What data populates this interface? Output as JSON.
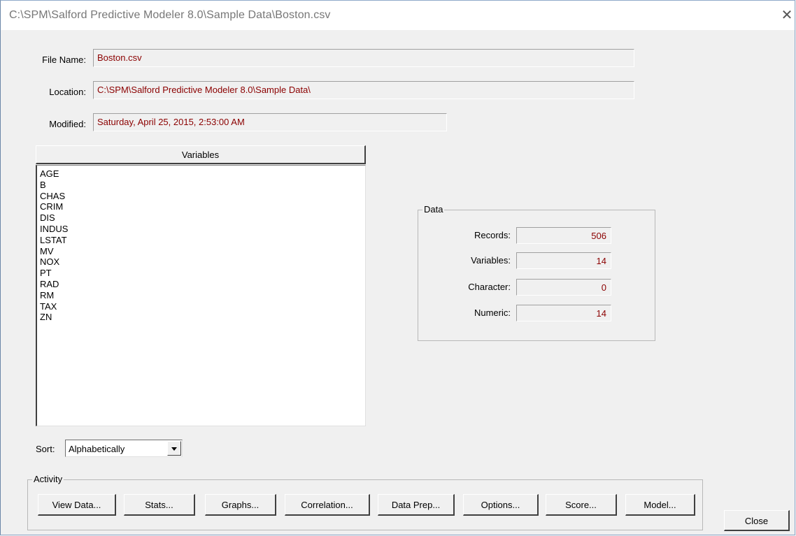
{
  "window": {
    "title": "C:\\SPM\\Salford Predictive Modeler 8.0\\Sample Data\\Boston.csv"
  },
  "file_info": {
    "file_name_label": "File Name:",
    "file_name": "Boston.csv",
    "location_label": "Location:",
    "location": "C:\\SPM\\Salford Predictive Modeler 8.0\\Sample Data\\",
    "modified_label": "Modified:",
    "modified": "Saturday, April 25, 2015, 2:53:00 AM"
  },
  "variables": {
    "header": "Variables",
    "items": [
      "AGE",
      "B",
      "CHAS",
      "CRIM",
      "DIS",
      "INDUS",
      "LSTAT",
      "MV",
      "NOX",
      "PT",
      "RAD",
      "RM",
      "TAX",
      "ZN"
    ]
  },
  "sort": {
    "label": "Sort:",
    "selected": "Alphabetically"
  },
  "data_group": {
    "title": "Data",
    "rows": [
      {
        "label": "Records:",
        "value": "506"
      },
      {
        "label": "Variables:",
        "value": "14"
      },
      {
        "label": "Character:",
        "value": "0"
      },
      {
        "label": "Numeric:",
        "value": "14"
      }
    ]
  },
  "activity": {
    "title": "Activity",
    "buttons": [
      "View Data...",
      "Stats...",
      "Graphs...",
      "Correlation...",
      "Data Prep...",
      "Options...",
      "Score...",
      "Model..."
    ]
  },
  "close_button": "Close",
  "colors": {
    "value_text": "#8b0000",
    "dialog_bg": "#f0f0f0",
    "title_text": "#777777"
  }
}
